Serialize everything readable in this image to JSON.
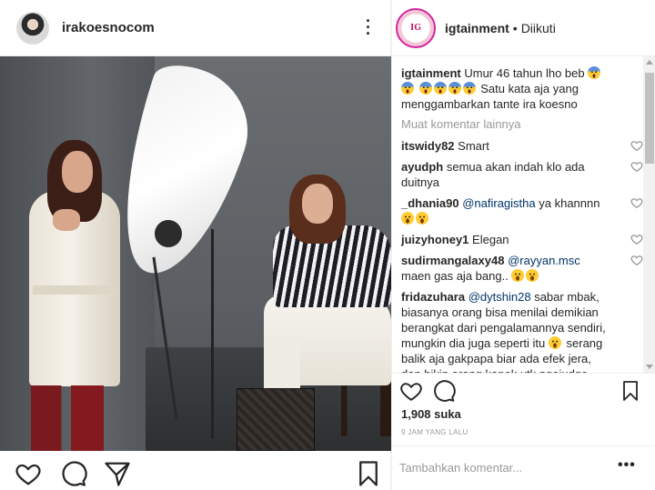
{
  "left_post": {
    "username": "irakoesnocom"
  },
  "right_post": {
    "username": "igtainment",
    "separator": "•",
    "follow_status": "Diikuti",
    "caption": {
      "user": "igtainment",
      "text_before": "Umur 46 tahun lho beb",
      "text_after": "Satu kata aja yang menggambarkan tante ira koesno"
    },
    "load_more": "Muat komentar lainnya",
    "comments": [
      {
        "user": "itswidy82",
        "text": "Smart"
      },
      {
        "user": "ayudph",
        "text": "semua akan indah klo ada duitnya"
      },
      {
        "user": "_dhania90",
        "mention": "@nafiragistha",
        "text": "ya khannnn"
      },
      {
        "user": "juizyhoney1",
        "text": "Elegan"
      },
      {
        "user": "sudirmangalaxy48",
        "mention": "@rayyan.msc",
        "text": "maen gas aja bang.."
      },
      {
        "user": "fridazuhara",
        "mention": "@dytshin28",
        "text": "sabar mbak, biasanya orang bisa menilai demikian berangkat dari pengalamannya sendiri, mungkin dia juga seperti itu",
        "text2": "serang balik aja gakpapa biar ada efek jera, dan bikin orang kapok utk ngejudge"
      }
    ],
    "likes": "1,908 suka",
    "time_ago": "9 JAM YANG LALU",
    "add_comment_placeholder": "Tambahkan komentar...",
    "more_options": "•••"
  },
  "icons": {
    "like": "heart-icon",
    "comment": "comment-icon",
    "share": "share-icon",
    "save": "bookmark-icon",
    "more": "more-vertical-icon"
  },
  "colors": {
    "mention": "#003569",
    "meta": "#999999",
    "avatar_ring": "#d6249f"
  }
}
